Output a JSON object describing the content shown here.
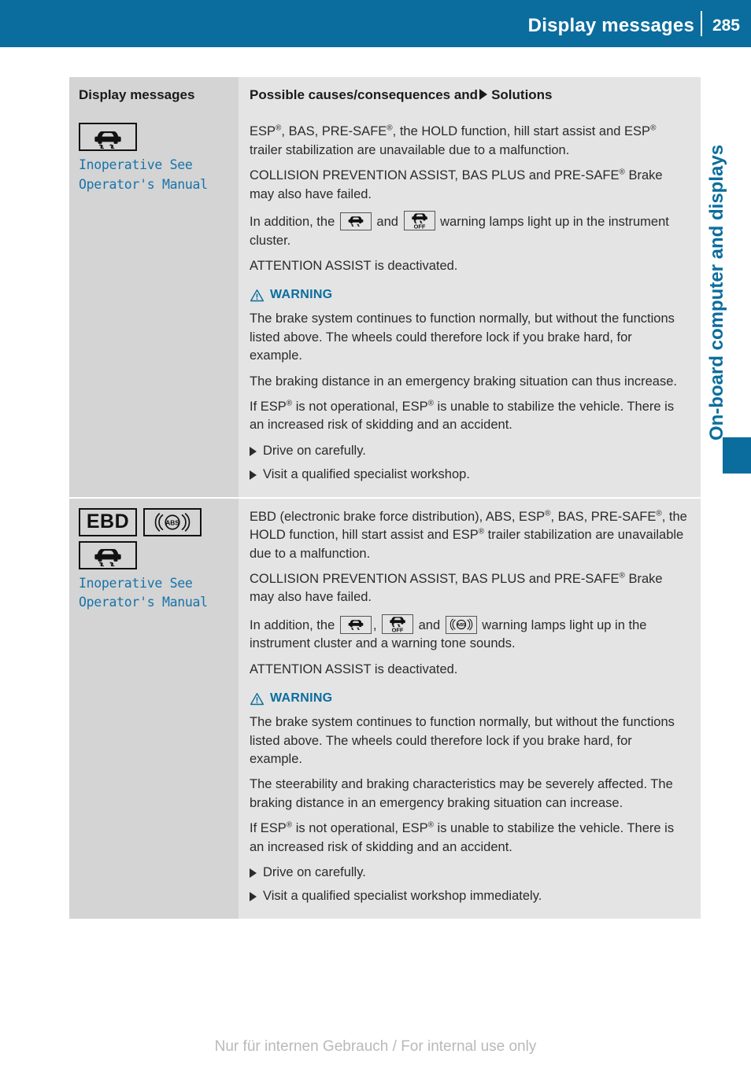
{
  "header": {
    "title": "Display messages",
    "page_number": "285",
    "accent_color": "#0a6d9e"
  },
  "side_tab": {
    "label": "On-board computer and displays"
  },
  "table": {
    "col_headers": {
      "left": "Display messages",
      "right_before": "Possible causes/consequences and",
      "right_after": "Solutions"
    },
    "rows": [
      {
        "symbols": [
          "esp-skid-icon"
        ],
        "display_message": "Inoperative See\nOperator's Manual",
        "paragraphs": [
          {
            "type": "text",
            "runs": [
              {
                "t": "ESP"
              },
              {
                "t": "®",
                "sup": true
              },
              {
                "t": ", BAS, PRE-SAFE"
              },
              {
                "t": "®",
                "sup": true
              },
              {
                "t": ", the HOLD function, hill start assist and ESP"
              },
              {
                "t": "®",
                "sup": true
              },
              {
                "t": " trailer stabilization are unavailable due to a malfunction."
              }
            ]
          },
          {
            "type": "text",
            "runs": [
              {
                "t": "COLLISION PREVENTION ASSIST, BAS PLUS and PRE-SAFE"
              },
              {
                "t": "®",
                "sup": true
              },
              {
                "t": " Brake may also have failed."
              }
            ]
          },
          {
            "type": "text",
            "runs": [
              {
                "t": "In addition, the "
              },
              {
                "icon": "esp-skid-icon"
              },
              {
                "t": " and "
              },
              {
                "icon": "esp-off-icon"
              },
              {
                "t": " warning lamps light up in the instrument cluster."
              }
            ]
          },
          {
            "type": "text",
            "runs": [
              {
                "t": "ATTENTION ASSIST is deactivated."
              }
            ]
          }
        ],
        "warning": {
          "label": "WARNING",
          "paragraphs": [
            {
              "type": "text",
              "runs": [
                {
                  "t": "The brake system continues to function normally, but without the functions listed above. The wheels could therefore lock if you brake hard, for example."
                }
              ]
            },
            {
              "type": "text",
              "runs": [
                {
                  "t": "The braking distance in an emergency braking situation can thus increase."
                }
              ]
            },
            {
              "type": "text",
              "runs": [
                {
                  "t": "If ESP"
                },
                {
                  "t": "®",
                  "sup": true
                },
                {
                  "t": " is not operational, ESP"
                },
                {
                  "t": "®",
                  "sup": true
                },
                {
                  "t": " is unable to stabilize the vehicle. There is an increased risk of skidding and an accident."
                }
              ]
            }
          ]
        },
        "solutions": [
          "Drive on carefully.",
          "Visit a qualified specialist workshop."
        ]
      },
      {
        "symbols": [
          "ebd-icon",
          "abs-icon",
          "esp-skid-icon"
        ],
        "display_message": "Inoperative See\nOperator's Manual",
        "paragraphs": [
          {
            "type": "text",
            "runs": [
              {
                "t": "EBD (electronic brake force distribution), ABS, ESP"
              },
              {
                "t": "®",
                "sup": true
              },
              {
                "t": ", BAS, PRE-SAFE"
              },
              {
                "t": "®",
                "sup": true
              },
              {
                "t": ", the HOLD function, hill start assist and ESP"
              },
              {
                "t": "®",
                "sup": true
              },
              {
                "t": " trailer stabilization are unavailable due to a malfunction."
              }
            ]
          },
          {
            "type": "text",
            "runs": [
              {
                "t": "COLLISION PREVENTION ASSIST, BAS PLUS and PRE-SAFE"
              },
              {
                "t": "®",
                "sup": true
              },
              {
                "t": " Brake may also have failed."
              }
            ]
          },
          {
            "type": "text",
            "runs": [
              {
                "t": "In addition, the "
              },
              {
                "icon": "esp-skid-icon"
              },
              {
                "t": ", "
              },
              {
                "icon": "esp-off-icon"
              },
              {
                "t": " and "
              },
              {
                "icon": "abs-icon"
              },
              {
                "t": " warning lamps light up in the instrument cluster and a warning tone sounds."
              }
            ]
          },
          {
            "type": "text",
            "runs": [
              {
                "t": "ATTENTION ASSIST is deactivated."
              }
            ]
          }
        ],
        "warning": {
          "label": "WARNING",
          "paragraphs": [
            {
              "type": "text",
              "runs": [
                {
                  "t": "The brake system continues to function normally, but without the functions listed above. The wheels could therefore lock if you brake hard, for example."
                }
              ]
            },
            {
              "type": "text",
              "runs": [
                {
                  "t": "The steerability and braking characteristics may be severely affected. The braking distance in an emergency braking situation can increase."
                }
              ]
            },
            {
              "type": "text",
              "runs": [
                {
                  "t": "If ESP"
                },
                {
                  "t": "®",
                  "sup": true
                },
                {
                  "t": " is not operational, ESP"
                },
                {
                  "t": "®",
                  "sup": true
                },
                {
                  "t": " is unable to stabilize the vehicle. There is an increased risk of skidding and an accident."
                }
              ]
            }
          ]
        },
        "solutions": [
          "Drive on carefully.",
          "Visit a qualified specialist workshop immediately."
        ]
      }
    ]
  },
  "footer": {
    "note": "Nur für internen Gebrauch / For internal use only"
  },
  "symbol_labels": {
    "ebd-icon": "EBD",
    "abs-icon": "ABS",
    "esp-skid-icon": "",
    "esp-off-icon": "OFF"
  }
}
